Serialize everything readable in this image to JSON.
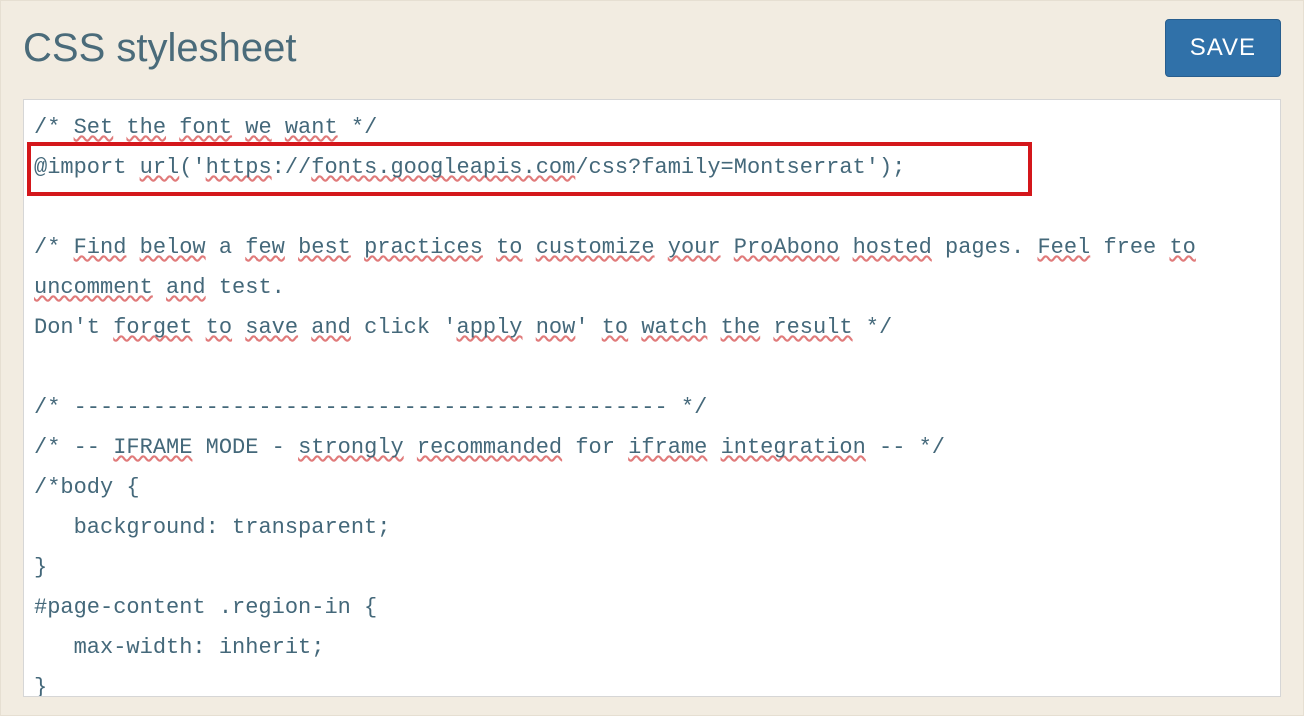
{
  "header": {
    "title": "CSS stylesheet",
    "save_label": "SAVE"
  },
  "editor": {
    "lines": [
      "/* Set the font we want */",
      "@import url('https://fonts.googleapis.com/css?family=Montserrat');",
      "",
      "/* Find below a few best practices to customize your ProAbono hosted pages. Feel free to uncomment and test.",
      "Don't forget to save and click 'apply now' to watch the result */",
      "",
      "/* --------------------------------------------- */",
      "/* -- IFRAME MODE - strongly recommanded for iframe integration -- */",
      "/*body {",
      "   background: transparent;",
      "}",
      "#page-content .region-in {",
      "   max-width: inherit;",
      "}"
    ],
    "spellcheck_words": [
      "Set",
      "the",
      "font",
      "we",
      "want",
      "url",
      "https",
      "fonts.googleapis.com",
      "css?family",
      "Find",
      "below",
      "few",
      "best",
      "practices",
      "to",
      "customize",
      "your",
      "ProAbono",
      "hosted",
      "Feel",
      "uncomment",
      "and",
      "forget",
      "save",
      "apply",
      "now",
      "watch",
      "the",
      "result",
      "IFRAME",
      "strongly",
      "recommanded",
      "iframe",
      "integration",
      "region",
      "width"
    ]
  }
}
